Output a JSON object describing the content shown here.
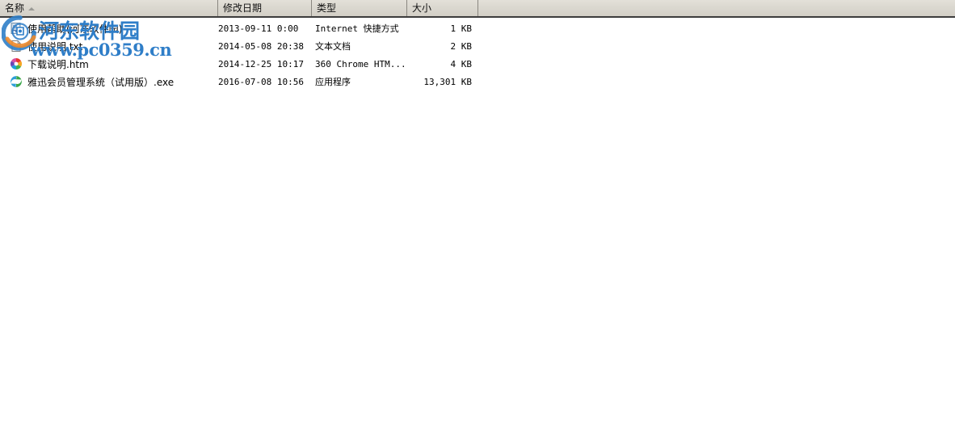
{
  "columns": [
    {
      "key": "name",
      "label": "名称",
      "sorted": true,
      "sort_direction": "ascending"
    },
    {
      "key": "date",
      "label": "修改日期",
      "sorted": false,
      "sort_direction": ""
    },
    {
      "key": "type",
      "label": "类型",
      "sorted": false,
      "sort_direction": ""
    },
    {
      "key": "size",
      "label": "大小",
      "sorted": false,
      "sort_direction": ""
    }
  ],
  "files": [
    {
      "name": "使用帮助(河东软件园)",
      "date": "2013-09-11 0:00",
      "type": "Internet 快捷方式",
      "size": "1 KB",
      "icon": "internet-shortcut-icon"
    },
    {
      "name": "使用说明.txt",
      "date": "2014-05-08 20:38",
      "type": "文本文档",
      "size": "2 KB",
      "icon": "text-document-icon"
    },
    {
      "name": "下载说明.htm",
      "date": "2014-12-25 10:17",
      "type": "360 Chrome HTM...",
      "size": "4 KB",
      "icon": "chrome-360-icon"
    },
    {
      "name": "雅迅会员管理系统（试用版）.exe",
      "date": "2016-07-08 10:56",
      "type": "应用程序",
      "size": "13,301 KB",
      "icon": "application-swirl-icon"
    }
  ],
  "watermark": {
    "site_name": "河东软件园",
    "site_url": "www.pc0359.cn",
    "color": "#2f7ec8"
  },
  "colors": {
    "header_background": "#d9d6ce",
    "header_border": "#3d3d3d",
    "column_divider": "#8a8780",
    "body_background": "#ffffff",
    "text": "#000000",
    "watermark_blue": "#2f7ec8",
    "watermark_orange": "#f08a2a"
  }
}
